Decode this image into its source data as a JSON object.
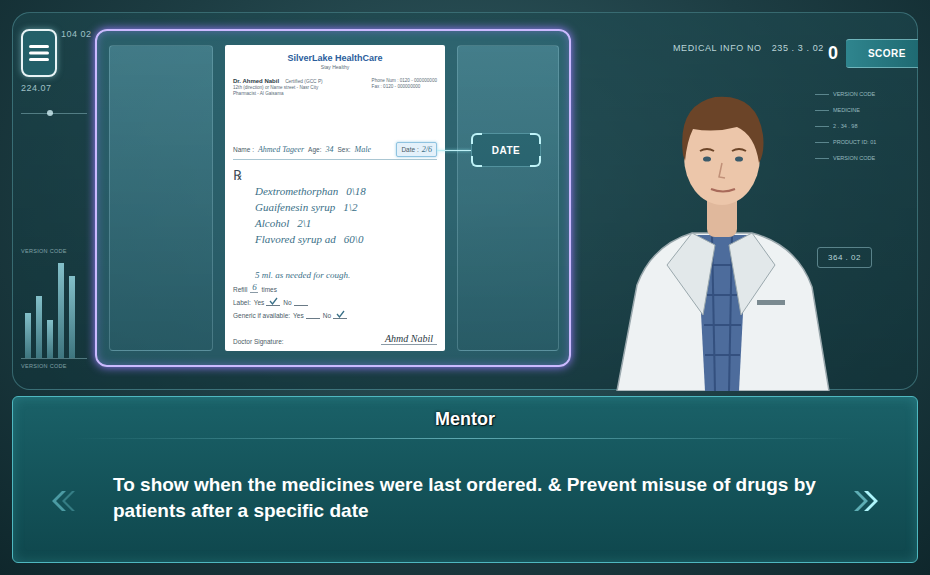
{
  "hud_left": {
    "codes": [
      "104 02",
      "224.07"
    ],
    "labels": [
      "VERSION CODE",
      "VERSION CODE"
    ],
    "bars": [
      {
        "level": 0.45
      },
      {
        "level": 0.62
      },
      {
        "level": 0.38
      },
      {
        "level": 0.95
      },
      {
        "level": 0.82
      }
    ]
  },
  "prescription": {
    "clinic": "SilverLake HealthCare",
    "tagline": "Stay Healthy",
    "doctor": {
      "name": "Dr. Ahmed Nabil",
      "title": "Certified (GCC P)",
      "address": [
        "12th (direction) or Name street - Nasr City",
        "Pharmacist - Al Gaisama"
      ],
      "contact": [
        "Phone Num : 0120 - 000000000",
        "Fax : 0120 - 000000000"
      ]
    },
    "patient": {
      "name_label": "Name :",
      "name": "Ahmed Tageer",
      "age_label": "Age:",
      "age": "34",
      "sex_label": "Sex:",
      "sex": "Male",
      "date_label": "Date :",
      "date": "2/6",
      "date_highlighted": true
    },
    "rx_symbol": "℞",
    "ingredients": [
      {
        "name": "Dextromethorphan",
        "amount": "0\\18"
      },
      {
        "name": "Guaifenesin syrup",
        "amount": "1\\2"
      },
      {
        "name": "Alcohol",
        "amount": "2\\1"
      },
      {
        "name": "Flavored syrup ad",
        "amount": "60\\0"
      }
    ],
    "directions": "5 ml. as needed for cough.",
    "refill": {
      "label": "Refill",
      "count": "6",
      "unit": "times"
    },
    "options": [
      {
        "label": "Label:",
        "choices": [
          {
            "text": "Yes",
            "checked": true
          },
          {
            "text": "No",
            "checked": false
          }
        ]
      },
      {
        "label": "Generic if available:",
        "choices": [
          {
            "text": "Yes",
            "checked": false
          },
          {
            "text": "No",
            "checked": true
          }
        ]
      }
    ],
    "signature_label": "Doctor Signature:",
    "signature": "Ahmd Nabil"
  },
  "date_button": {
    "label": "DATE"
  },
  "hud_right": {
    "info_label": "MEDICAL INFO NO",
    "info_number": "235 . 3 . 02",
    "labels": [
      "VERSION CODE",
      "MEDICINE",
      "2 . 34 . 98",
      "PRODUCT ID: 01",
      "VERSION CODE"
    ],
    "code": "364 . 02"
  },
  "score": {
    "value": "0",
    "label": "SCORE"
  },
  "dialog": {
    "speaker": "Mentor",
    "text": "To show when the medicines were last ordered. & Prevent misuse of drugs by patients after a specific date"
  }
}
